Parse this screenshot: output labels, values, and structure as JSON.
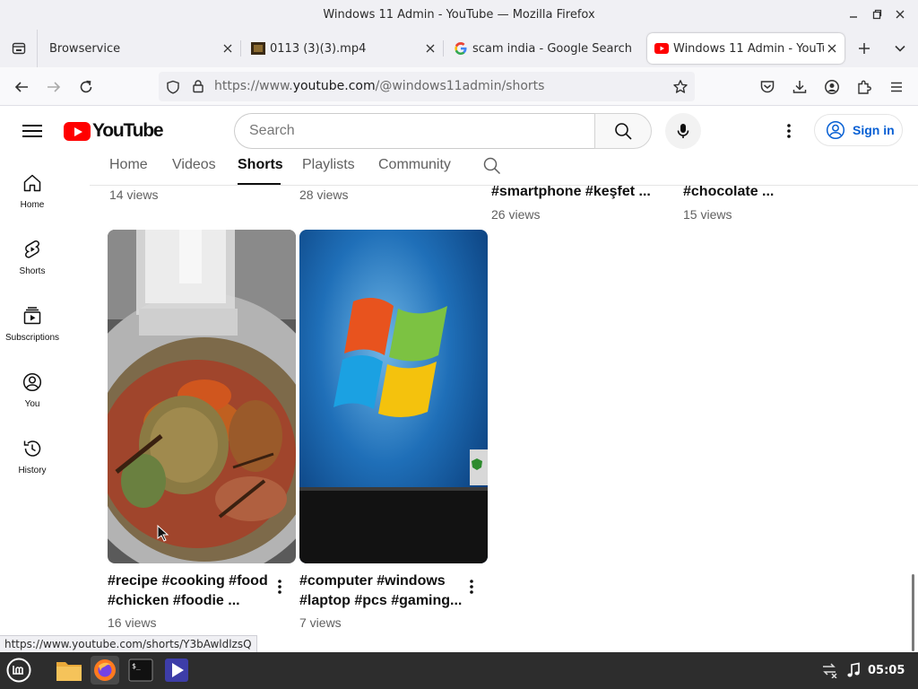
{
  "window": {
    "title": "Windows 11 Admin - YouTube — Mozilla Firefox"
  },
  "tabs": [
    {
      "label": "Browservice",
      "favicon": "none"
    },
    {
      "label": "0113 (3)(3).mp4",
      "favicon": "video-icon"
    },
    {
      "label": "scam india - Google Search",
      "favicon": "google-icon"
    },
    {
      "label": "Windows 11 Admin - YouTube",
      "favicon": "youtube-icon",
      "active": true
    }
  ],
  "navbar": {
    "url_prefix": "https://www.",
    "url_domain": "youtube.com",
    "url_path": "/@windows11admin/shorts"
  },
  "youtube": {
    "logo_text": "YouTube",
    "search_placeholder": "Search",
    "sign_in_label": "Sign in",
    "brand_color": "#ff0000",
    "link_color": "#065fd4"
  },
  "channel_tabs": [
    {
      "label": "Home"
    },
    {
      "label": "Videos"
    },
    {
      "label": "Shorts",
      "active": true
    },
    {
      "label": "Playlists"
    },
    {
      "label": "Community"
    }
  ],
  "guide": [
    {
      "label": "Home",
      "icon": "home-icon"
    },
    {
      "label": "Shorts",
      "icon": "shorts-icon"
    },
    {
      "label": "Subscriptions",
      "icon": "subscriptions-icon"
    },
    {
      "label": "You",
      "icon": "you-icon"
    },
    {
      "label": "History",
      "icon": "history-icon"
    }
  ],
  "top_row": [
    {
      "title_tail": "",
      "views": "14 views"
    },
    {
      "title_tail": "",
      "views": "28 views"
    },
    {
      "title_tail": "#smartphone #keşfet ...",
      "views": "26 views"
    },
    {
      "title_tail": "#chocolate ...",
      "views": "15 views"
    }
  ],
  "shorts": [
    {
      "title_line1": "#recipe #cooking #food",
      "title_line2": "#chicken #foodie ...",
      "views": "16 views",
      "thumb": "cooking-pot"
    },
    {
      "title_line1": "#computer #windows",
      "title_line2": "#laptop #pcs #gaming...",
      "views": "7 views",
      "thumb": "windows-logo-screen"
    }
  ],
  "status_url": "https://www.youtube.com/shorts/Y3bAwldlzsQ",
  "taskbar": {
    "clock": "05:05"
  }
}
